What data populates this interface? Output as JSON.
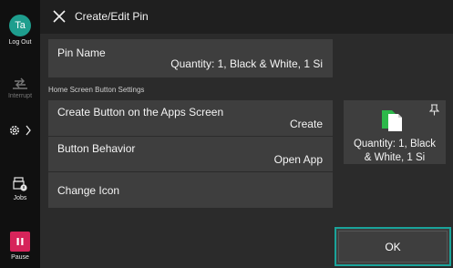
{
  "sidebar": {
    "avatar_initials": "Ta",
    "logout_label": "Log Out",
    "interrupt_label": "Interrupt",
    "jobs_label": "Jobs",
    "pause_label": "Pause",
    "settings_icon": "gear-icon",
    "accent_avatar": "#1e9e8e",
    "accent_pause": "#d6245a"
  },
  "header": {
    "title": "Create/Edit Pin",
    "close_icon": "close-icon"
  },
  "form": {
    "pin_name": {
      "label": "Pin Name",
      "value": "Quantity: 1, Black & White, 1 Si"
    },
    "section_label": "Home Screen Button Settings",
    "create_button": {
      "label": "Create Button on the Apps Screen",
      "value": "Create"
    },
    "button_behavior": {
      "label": "Button Behavior",
      "value": "Open App"
    },
    "change_icon": {
      "label": "Change Icon"
    }
  },
  "preview": {
    "text_line1": "Quantity: 1, Black",
    "text_line2": "& White, 1 Si",
    "pin_icon": "pin-icon",
    "app_icon": "copy-app-icon"
  },
  "footer": {
    "ok_label": "OK",
    "accent": "#1aa39a"
  }
}
